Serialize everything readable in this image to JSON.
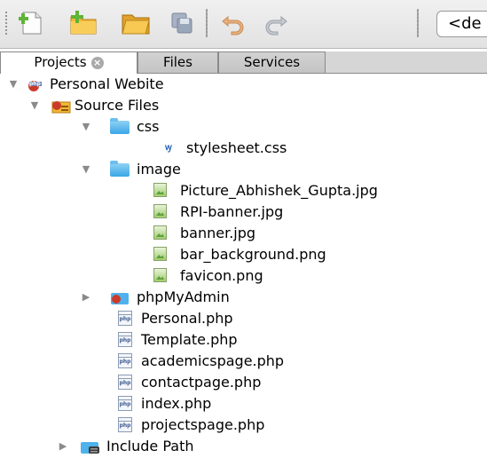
{
  "toolbar": {
    "buttons": [
      {
        "icon": "new-file-icon"
      },
      {
        "icon": "new-project-icon"
      },
      {
        "icon": "open-project-icon"
      },
      {
        "icon": "save-all-icon"
      },
      {
        "icon": "undo-icon"
      },
      {
        "icon": "redo-icon"
      }
    ],
    "config_combo": "<de"
  },
  "tabs": [
    {
      "label": "Projects",
      "active": true,
      "closable": true
    },
    {
      "label": "Files",
      "active": false
    },
    {
      "label": "Services",
      "active": false
    }
  ],
  "tree": {
    "project": "Personal Webite",
    "source_files": "Source Files",
    "css_folder": "css",
    "css_files": [
      "stylesheet.css"
    ],
    "image_folder": "image",
    "image_files": [
      "Picture_Abhishek_Gupta.jpg",
      "RPI-banner.jpg",
      "banner.jpg",
      "bar_background.png",
      "favicon.png"
    ],
    "phpmyadmin": "phpMyAdmin",
    "php_files": [
      "Personal.php",
      "Template.php",
      "academicspage.php",
      "contactpage.php",
      "index.php",
      "projectspage.php"
    ],
    "include_path": "Include Path"
  },
  "colors": {
    "folder": "#4fb2ec",
    "toolbar_bg": "#e8e8e8",
    "tab_bg": "#c8c8c8"
  }
}
